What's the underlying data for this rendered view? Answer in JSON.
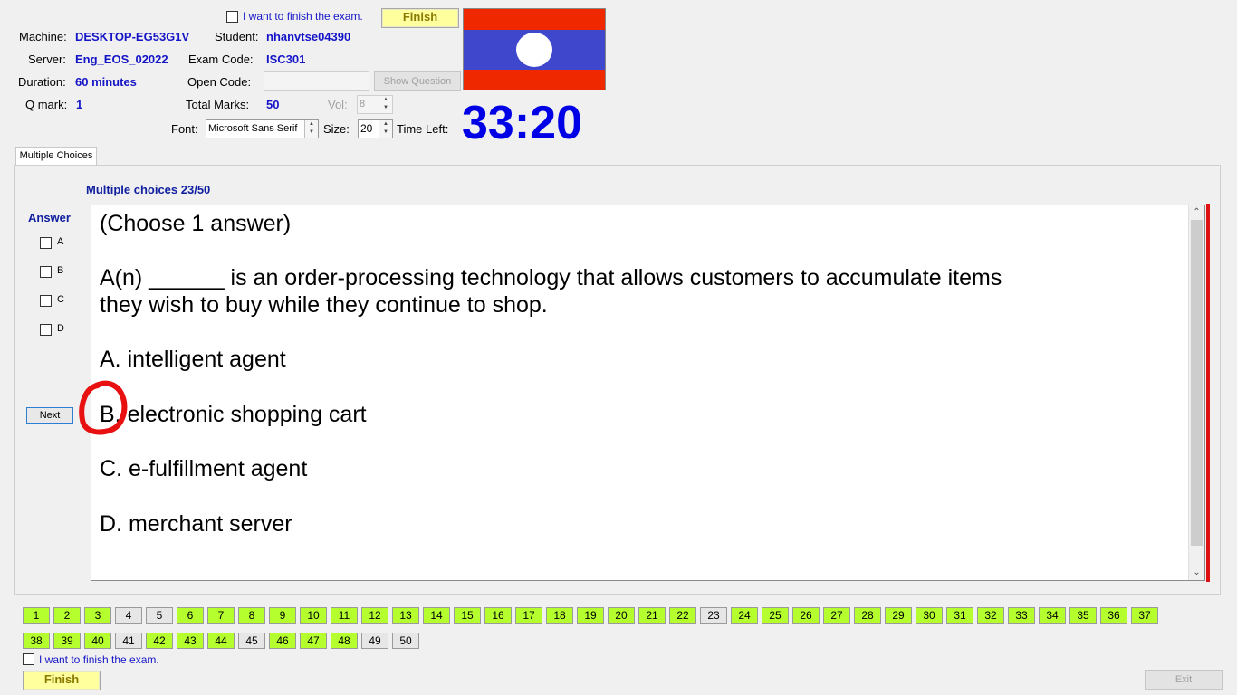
{
  "header": {
    "finish_checkbox_label": "I want to finish the exam.",
    "finish_button": "Finish",
    "machine_label": "Machine:",
    "machine": "DESKTOP-EG53G1V",
    "student_label": "Student:",
    "student": "nhanvtse04390",
    "server_label": "Server:",
    "server": "Eng_EOS_02022",
    "exam_code_label": "Exam Code:",
    "exam_code": "ISC301",
    "duration_label": "Duration:",
    "duration": "60 minutes",
    "open_code_label": "Open Code:",
    "open_code_value": "",
    "show_question_button": "Show Question",
    "qmark_label": "Q mark:",
    "qmark": "1",
    "total_marks_label": "Total Marks:",
    "total_marks": "50",
    "vol_label": "Vol:",
    "vol": "8",
    "font_label": "Font:",
    "font_value": "Microsoft Sans Serif",
    "size_label": "Size:",
    "size_value": "20",
    "time_left_label": "Time Left:",
    "time_left": "33:20",
    "flag_colors": {
      "top": "#f02800",
      "middle": "#3f48cc",
      "circle": "#ffffff"
    }
  },
  "tab": {
    "label": "Multiple Choices"
  },
  "question_panel": {
    "counter": "Multiple choices 23/50",
    "answer_label": "Answer",
    "options": [
      "A",
      "B",
      "C",
      "D"
    ],
    "next_button": "Next",
    "lines": [
      "(Choose 1 answer)",
      "A(n) ______ is an order-processing technology that allows customers to accumulate items",
      "they wish to buy while they continue to shop.",
      "A.  intelligent agent",
      "B.  electronic shopping cart",
      "C.  e-fulfillment agent",
      "D.  merchant server"
    ]
  },
  "navigator": {
    "row1": [
      {
        "n": "1",
        "done": true
      },
      {
        "n": "2",
        "done": true
      },
      {
        "n": "3",
        "done": true
      },
      {
        "n": "4",
        "done": false
      },
      {
        "n": "5",
        "done": false
      },
      {
        "n": "6",
        "done": true
      },
      {
        "n": "7",
        "done": true
      },
      {
        "n": "8",
        "done": true
      },
      {
        "n": "9",
        "done": true
      },
      {
        "n": "10",
        "done": true
      },
      {
        "n": "11",
        "done": true
      },
      {
        "n": "12",
        "done": true
      },
      {
        "n": "13",
        "done": true
      },
      {
        "n": "14",
        "done": true
      },
      {
        "n": "15",
        "done": true
      },
      {
        "n": "16",
        "done": true
      },
      {
        "n": "17",
        "done": true
      },
      {
        "n": "18",
        "done": true
      },
      {
        "n": "19",
        "done": true
      },
      {
        "n": "20",
        "done": true
      },
      {
        "n": "21",
        "done": true
      },
      {
        "n": "22",
        "done": true
      },
      {
        "n": "23",
        "done": false
      },
      {
        "n": "24",
        "done": true
      },
      {
        "n": "25",
        "done": true
      },
      {
        "n": "26",
        "done": true
      },
      {
        "n": "27",
        "done": true
      },
      {
        "n": "28",
        "done": true
      },
      {
        "n": "29",
        "done": true
      },
      {
        "n": "30",
        "done": true
      },
      {
        "n": "31",
        "done": true
      },
      {
        "n": "32",
        "done": true
      },
      {
        "n": "33",
        "done": true
      },
      {
        "n": "34",
        "done": true
      },
      {
        "n": "35",
        "done": true
      },
      {
        "n": "36",
        "done": true
      },
      {
        "n": "37",
        "done": true
      }
    ],
    "row2": [
      {
        "n": "38",
        "done": true
      },
      {
        "n": "39",
        "done": true
      },
      {
        "n": "40",
        "done": true
      },
      {
        "n": "41",
        "done": false
      },
      {
        "n": "42",
        "done": true
      },
      {
        "n": "43",
        "done": true
      },
      {
        "n": "44",
        "done": true
      },
      {
        "n": "45",
        "done": false
      },
      {
        "n": "46",
        "done": true
      },
      {
        "n": "47",
        "done": true
      },
      {
        "n": "48",
        "done": true
      },
      {
        "n": "49",
        "done": false
      },
      {
        "n": "50",
        "done": false
      }
    ]
  },
  "footer": {
    "finish_checkbox_label": "I want to finish the exam.",
    "finish_button": "Finish",
    "exit_button": "Exit"
  },
  "colors": {
    "answered": "#b5ff2e",
    "unanswered": "#e6e6e6",
    "accent_blue": "#1515c8",
    "timer_blue": "#0000e6",
    "scroll_red": "#e01010"
  }
}
